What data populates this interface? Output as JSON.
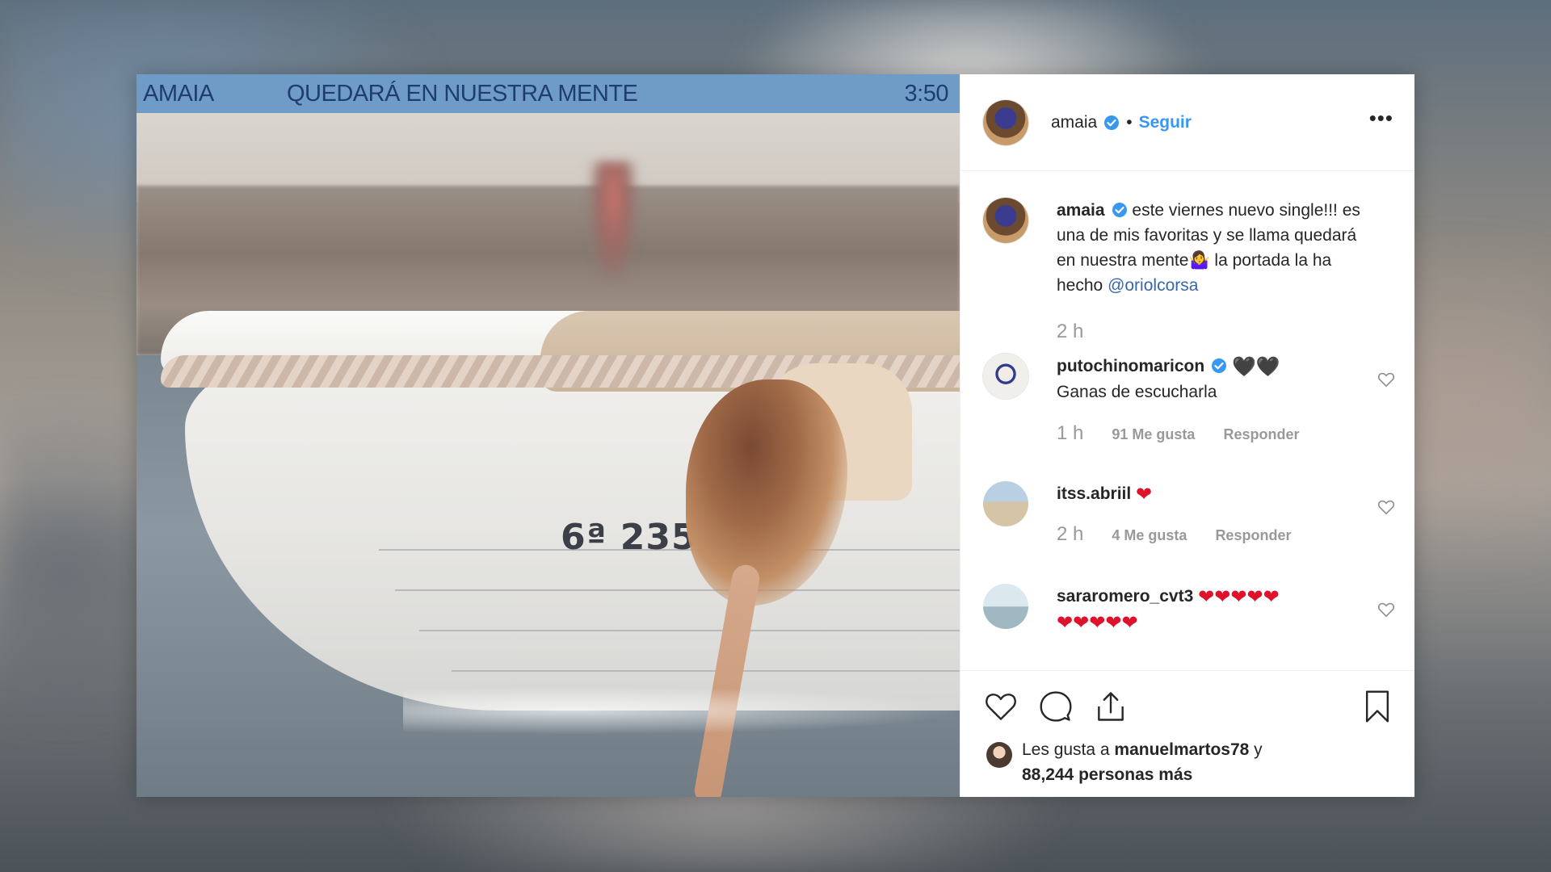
{
  "cover": {
    "artist": "AMAIA",
    "title": "QUEDARÁ EN NUESTRA MENTE",
    "duration": "3:50",
    "bar_color": "#6f9cc6",
    "text_color": "#1f3c73",
    "boat_registration": "6ª 235-10-7"
  },
  "header": {
    "username": "amaia",
    "separator": "•",
    "follow_label": "Seguir",
    "more_label": "•••"
  },
  "caption": {
    "username": "amaia",
    "text_before_emoji": "este viernes nuevo single!!! es una de mis favoritas y se llama quedará en nuestra mente",
    "emoji": "🤷‍♀️",
    "text_after_emoji": " la portada la ha hecho ",
    "mention": "@oriolcorsa",
    "time": "2 h"
  },
  "comments": [
    {
      "username": "putochinomaricon",
      "verified": true,
      "inline_hearts": "🖤🖤",
      "text": "Ganas de escucharla",
      "time": "1 h",
      "likes": "91 Me gusta",
      "reply": "Responder"
    },
    {
      "username": "itss.abriil",
      "verified": false,
      "inline_hearts": "❤",
      "text": "",
      "time": "2 h",
      "likes": "4 Me gusta",
      "reply": "Responder"
    },
    {
      "username": "sararomero_cvt3",
      "verified": false,
      "inline_hearts": "❤❤❤❤❤",
      "text": "❤❤❤❤❤"
    }
  ],
  "likes_summary": {
    "prefix": "Les gusta a ",
    "user": "manuelmartos78",
    "middle": " y",
    "count": "88,244 personas más"
  },
  "icons": {
    "like": "heart-outline-icon",
    "comment": "comment-bubble-icon",
    "share": "share-upload-icon",
    "save": "bookmark-icon",
    "verified": "verified-badge-icon"
  },
  "colors": {
    "link_blue": "#3897f0",
    "mention_blue": "#3867a8",
    "heart_red": "#e0112b",
    "meta_gray": "#999999"
  }
}
